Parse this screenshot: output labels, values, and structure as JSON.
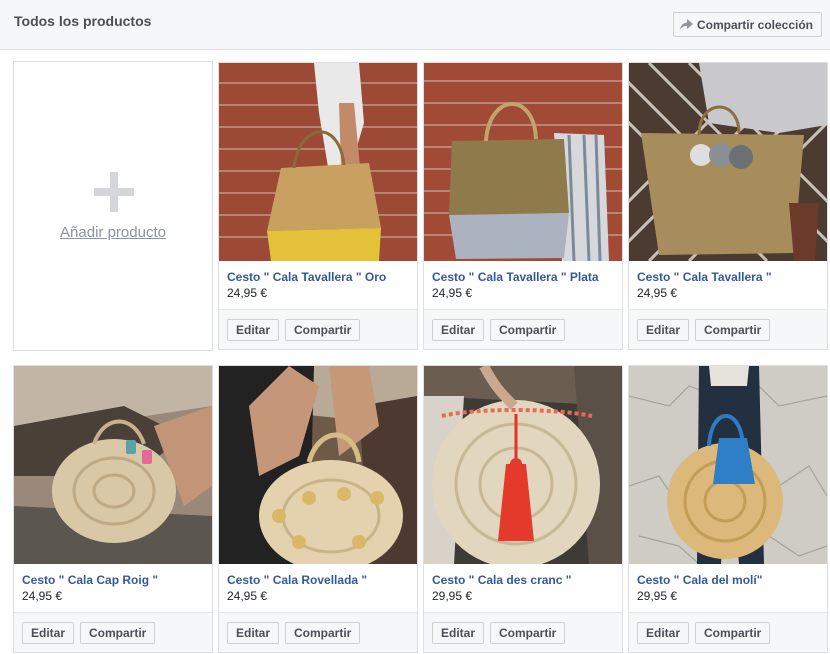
{
  "header": {
    "title": "Todos los productos",
    "share_collection_label": "Compartir colección"
  },
  "add_product": {
    "label": "Añadir producto"
  },
  "actions": {
    "edit_label": "Editar",
    "share_label": "Compartir"
  },
  "products": [
    {
      "name": "Cesto \" Cala Tavallera \" Oro",
      "price": "24,95 €"
    },
    {
      "name": "Cesto \" Cala Tavallera \" Plata",
      "price": "24,95 €"
    },
    {
      "name": "Cesto \" Cala Tavallera \"",
      "price": "24,95 €"
    },
    {
      "name": "Cesto \" Cala Cap Roig \"",
      "price": "24,95 €"
    },
    {
      "name": "Cesto \" Cala Rovellada \"",
      "price": "24,95 €"
    },
    {
      "name": "Cesto \" Cala des cranc \"",
      "price": "29,95 €"
    },
    {
      "name": "Cesto \" Cala del molí\"",
      "price": "29,95 €"
    }
  ]
}
